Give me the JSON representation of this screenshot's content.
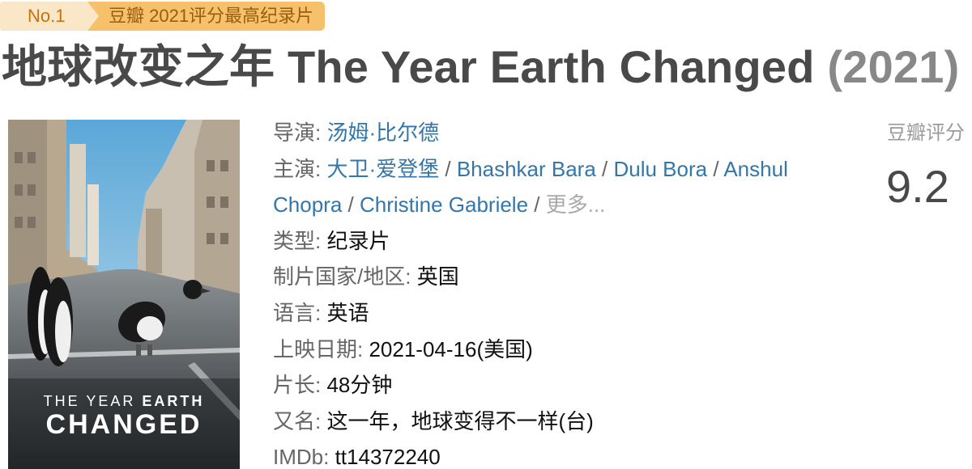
{
  "badge": {
    "rank": "No.1",
    "title": "豆瓣 2021评分最高纪录片"
  },
  "movie": {
    "title": "地球改变之年 The Year Earth Changed",
    "year": "(2021)"
  },
  "poster": {
    "line1_light": "THE YEAR ",
    "line1_bold": "EARTH",
    "line2": "CHANGED"
  },
  "info": {
    "director_label": "导演:",
    "director": "汤姆·比尔德",
    "cast_label": "主演:",
    "cast": [
      "大卫·爱登堡",
      "Bhashkar Bara",
      "Dulu Bora",
      "Anshul Chopra",
      "Christine Gabriele"
    ],
    "cast_separator": " / ",
    "cast_more": "更多...",
    "genre_label": "类型:",
    "genre": "纪录片",
    "country_label": "制片国家/地区:",
    "country": "英国",
    "language_label": "语言:",
    "language": "英语",
    "release_label": "上映日期:",
    "release": "2021-04-16(美国)",
    "runtime_label": "片长:",
    "runtime": "48分钟",
    "aka_label": "又名:",
    "aka": "这一年，地球变得不一样(台)",
    "imdb_label": "IMDb:",
    "imdb": "tt14372240"
  },
  "rating": {
    "label": "豆瓣评分",
    "score": "9.2"
  },
  "colors": {
    "link": "#3377aa",
    "badge_light": "#fae7c8",
    "badge_dark": "#f7c16c"
  }
}
